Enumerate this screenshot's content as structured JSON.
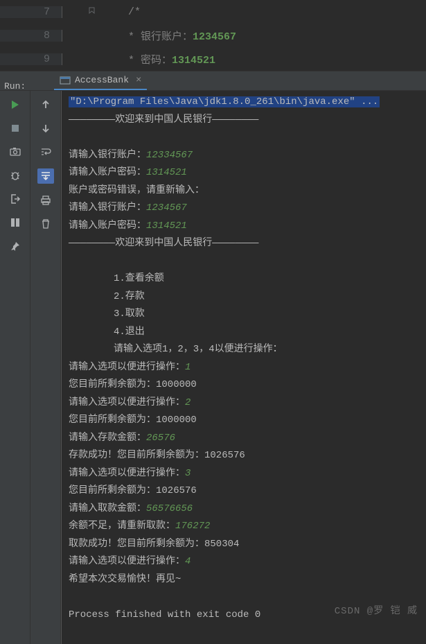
{
  "editor": {
    "lines": [
      {
        "num": "7",
        "text": "/*",
        "fold": true
      },
      {
        "num": "8",
        "text": " *  银行账户：",
        "value": "1234567"
      },
      {
        "num": "9",
        "text": " *  密码：",
        "value": "1314521"
      }
    ]
  },
  "run_label": "Run:",
  "tab": {
    "name": "AccessBank"
  },
  "toolbar_left": [
    "play-icon",
    "stop-icon",
    "camera-icon",
    "bug-icon",
    "exit-icon",
    "layout-icon",
    "pin-icon"
  ],
  "toolbar_mid": [
    "up-icon",
    "down-icon",
    "wrap-icon",
    "scroll-icon",
    "print-icon",
    "trash-icon"
  ],
  "console": {
    "cmd": "\"D:\\Program Files\\Java\\jdk1.8.0_261\\bin\\java.exe\" ...",
    "lines": [
      {
        "t": "————————欢迎来到中国人民银行————————"
      },
      {
        "t": ""
      },
      {
        "t": "请输入银行账户：",
        "in": "12334567"
      },
      {
        "t": "请输入账户密码：",
        "in": "1314521"
      },
      {
        "t": "账户或密码错误，请重新输入："
      },
      {
        "t": "请输入银行账户：",
        "in": "1234567"
      },
      {
        "t": "请输入账户密码：",
        "in": "1314521"
      },
      {
        "t": "————————欢迎来到中国人民银行————————"
      },
      {
        "t": ""
      },
      {
        "t": "1.查看余额",
        "indent": true
      },
      {
        "t": "2.存款",
        "indent": true
      },
      {
        "t": "3.取款",
        "indent": true
      },
      {
        "t": "4.退出",
        "indent": true
      },
      {
        "t": "请输入选项1，2，3，4以便进行操作：",
        "indent": true
      },
      {
        "t": "请输入选项以便进行操作：",
        "in": "1"
      },
      {
        "t": "您目前所剩余额为：1000000"
      },
      {
        "t": "请输入选项以便进行操作：",
        "in": "2"
      },
      {
        "t": "您目前所剩余额为：1000000"
      },
      {
        "t": "请输入存款金额：",
        "in": "26576"
      },
      {
        "t": "存款成功！您目前所剩余额为：1026576"
      },
      {
        "t": "请输入选项以便进行操作：",
        "in": "3"
      },
      {
        "t": "您目前所剩余额为：1026576"
      },
      {
        "t": "请输入取款金额：",
        "in": "56576656"
      },
      {
        "t": "余额不足，请重新取款：",
        "in": "176272"
      },
      {
        "t": "取款成功！您目前所剩余额为：850304"
      },
      {
        "t": "请输入选项以便进行操作：",
        "in": "4"
      },
      {
        "t": "希望本次交易愉快！再见~"
      },
      {
        "t": ""
      },
      {
        "t": "Process finished with exit code 0"
      }
    ]
  },
  "watermark": "CSDN @罗 铠 威"
}
